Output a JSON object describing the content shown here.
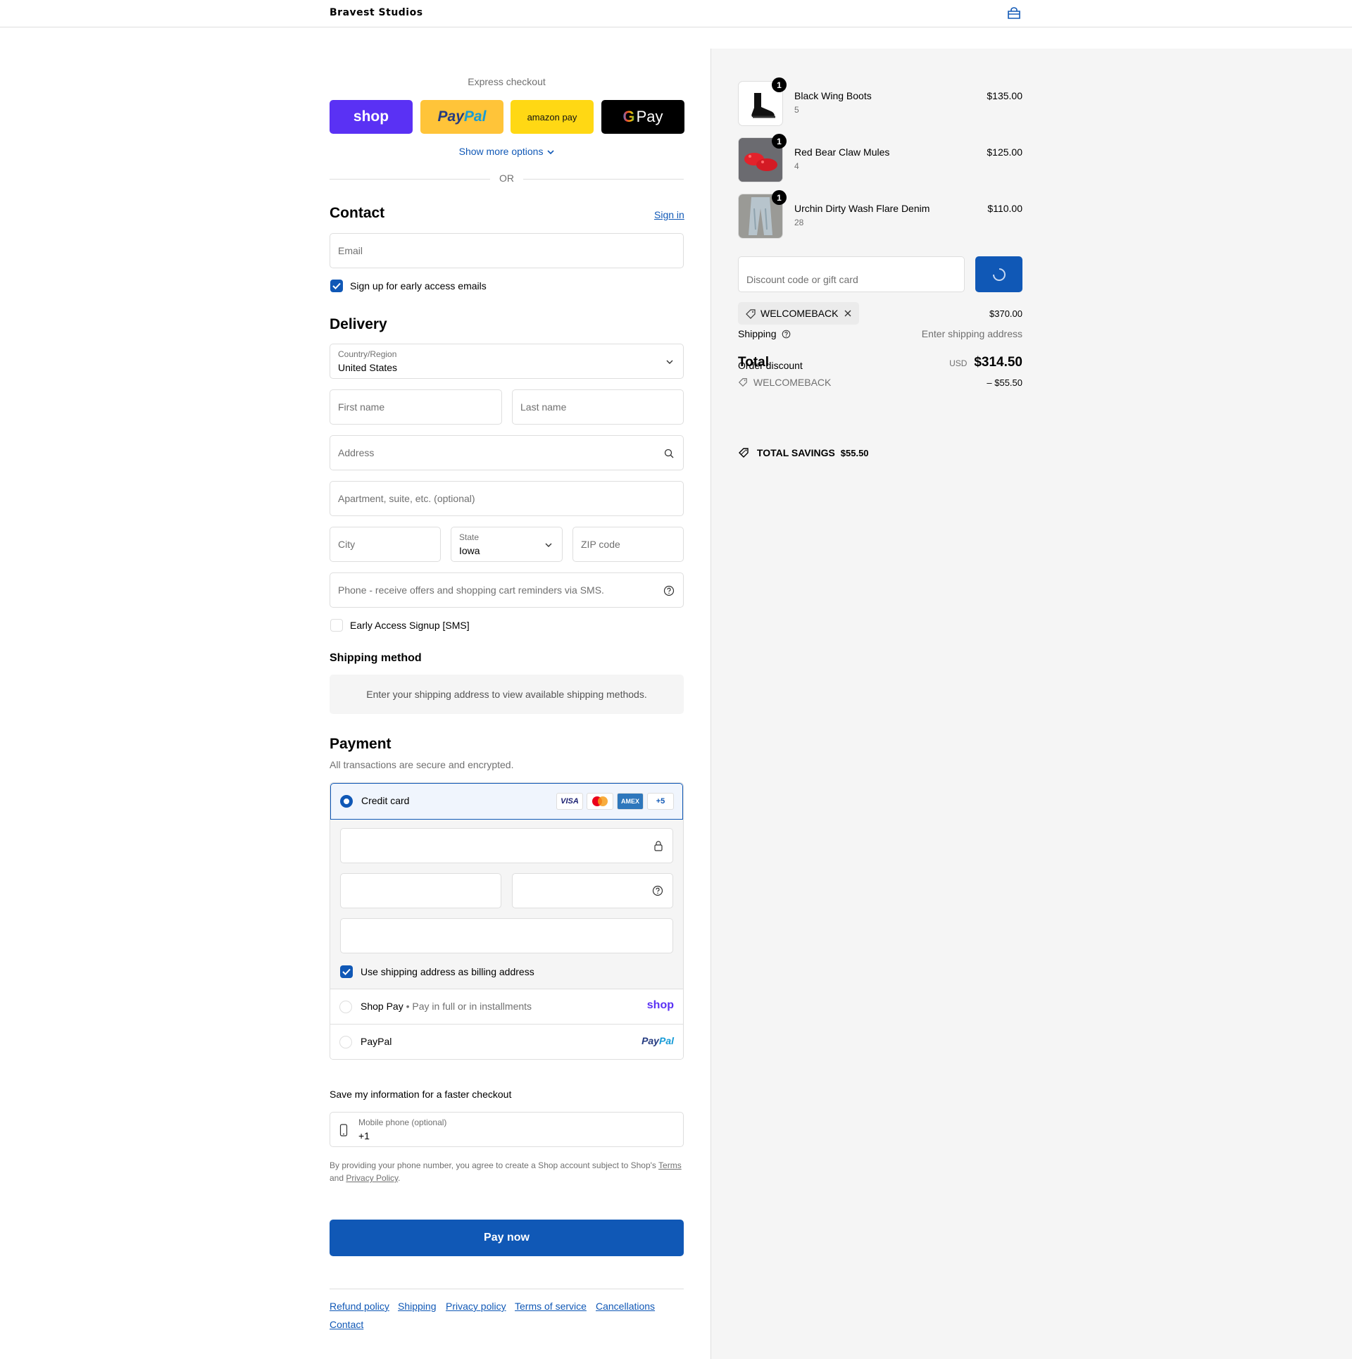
{
  "header": {
    "brand": "Bravest Studios",
    "cart_icon": "shopping-bag-icon"
  },
  "express": {
    "title": "Express checkout",
    "shop_label": "shop",
    "paypal_a": "Pay",
    "paypal_b": "Pal",
    "amazon_label": "amazon pay",
    "gpay_label": "Pay",
    "show_more": "Show more options",
    "or": "OR"
  },
  "contact": {
    "title": "Contact",
    "sign_in": "Sign in",
    "email_placeholder": "Email",
    "early_access": "Sign up for early access emails"
  },
  "delivery": {
    "title": "Delivery",
    "country_label": "Country/Region",
    "country_value": "United States",
    "first_name": "First name",
    "last_name": "Last name",
    "address": "Address",
    "apartment": "Apartment, suite, etc. (optional)",
    "city": "City",
    "state_label": "State",
    "state_value": "Iowa",
    "zip": "ZIP code",
    "phone": "Phone - receive offers and shopping cart reminders via SMS.",
    "sms_signup": "Early Access Signup [SMS]"
  },
  "shipping_method": {
    "title": "Shipping method",
    "message": "Enter your shipping address to view available shipping methods."
  },
  "payment": {
    "title": "Payment",
    "subtitle": "All transactions are secure and encrypted.",
    "credit_card": "Credit card",
    "card_logos": [
      "VISA",
      "",
      "AMEX",
      "+5"
    ],
    "billing_same": "Use shipping address as billing address",
    "shop_pay": "Shop Pay",
    "shop_pay_note": "Pay in full or in installments",
    "shop_pay_logo": "shop",
    "paypal": "PayPal",
    "paypal_logo_a": "Pay",
    "paypal_logo_b": "Pal"
  },
  "save_info": {
    "title": "Save my information for a faster checkout",
    "mobile_label": "Mobile phone (optional)",
    "mobile_value": "+1",
    "legal_1": "By providing your phone number, you agree to create a Shop account subject to Shop's",
    "terms": "Terms",
    "and": "and",
    "privacy": "Privacy Policy",
    "period": "."
  },
  "pay_now": "Pay now",
  "footer": {
    "links": [
      "Refund policy",
      "Shipping",
      "Privacy policy",
      "Terms of service",
      "Cancellations",
      "Contact"
    ]
  },
  "summary": {
    "items": [
      {
        "name": "Black Wing Boots",
        "variant": "5",
        "price": "$135.00",
        "qty": "1"
      },
      {
        "name": "Red Bear Claw Mules",
        "variant": "4",
        "price": "$125.00",
        "qty": "1"
      },
      {
        "name": "Urchin Dirty Wash Flare Denim",
        "variant": "28",
        "price": "$110.00",
        "qty": "1"
      }
    ],
    "discount_placeholder": "Discount code or gift card",
    "applied_code": "WELCOMEBACK",
    "subtotal": "$370.00",
    "shipping_label": "Shipping",
    "shipping_value": "Enter shipping address",
    "total_label": "Total",
    "order_discount_label": "Order discount",
    "currency": "USD",
    "total_value": "$314.50",
    "discount_code": "WELCOMEBACK",
    "discount_value": "– $55.50",
    "savings_label": "TOTAL SAVINGS",
    "savings_value": "$55.50"
  },
  "colors": {
    "accent": "#1058b6",
    "shop_purple": "#5a31f4",
    "paypal_yellow": "#ffc439",
    "amazon_yellow": "#ffd814"
  }
}
